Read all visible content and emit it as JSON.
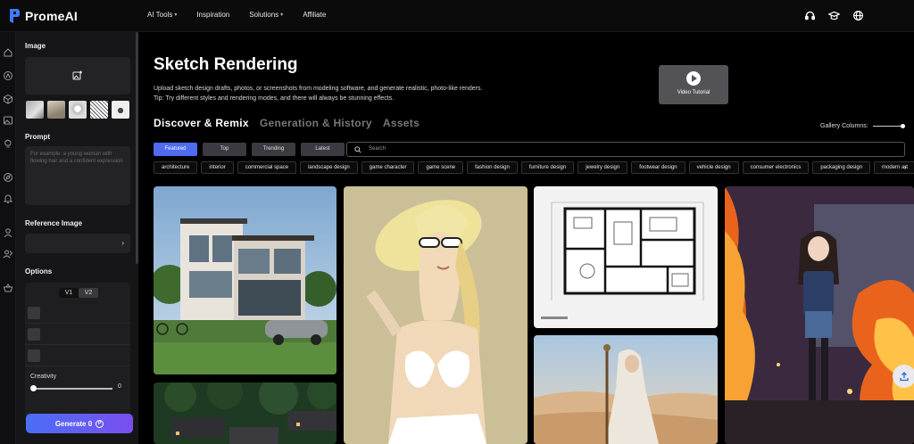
{
  "app": {
    "name": "PromeAI"
  },
  "nav": {
    "items": [
      {
        "label": "AI Tools",
        "has_caret": true
      },
      {
        "label": "Inspiration",
        "has_caret": false
      },
      {
        "label": "Solutions",
        "has_caret": true
      },
      {
        "label": "Affiliate",
        "has_caret": false
      }
    ]
  },
  "top_icons": [
    "headset-icon",
    "graduation-cap-icon",
    "globe-icon"
  ],
  "left_panel": {
    "image_label": "Image",
    "prompt_label": "Prompt",
    "prompt_placeholder": "For example: a young woman with flowing hair and a confident expression",
    "reference_label": "Reference Image",
    "options_label": "Options",
    "version_options": [
      "V1",
      "V2"
    ],
    "version_selected": "V2",
    "creativity_label": "Creativity",
    "creativity_value": "0",
    "generate_label": "Generate 0"
  },
  "main": {
    "title": "Sketch Rendering",
    "description_line1": "Upload sketch design drafts, photos, or screenshots from modeling software, and generate realistic, photo-like renders.",
    "description_line2": "Tip: Try different styles and rendering modes, and there will always be stunning effects.",
    "video_label": "Video Tutorial",
    "tabs": [
      "Discover & Remix",
      "Generation & History",
      "Assets"
    ],
    "active_tab": "Discover & Remix",
    "gallery_columns_label": "Gallery Columns:",
    "filters": [
      "Featured",
      "Top",
      "Trending",
      "Latest"
    ],
    "active_filter": "Featured",
    "search_placeholder": "Search",
    "categories": [
      "architecture",
      "interior",
      "commercial space",
      "landscape design",
      "game character",
      "game scene",
      "fashion design",
      "furniture design",
      "jewelry design",
      "footwear design",
      "vehicle design",
      "consumer electronics",
      "packaging design",
      "modern art"
    ]
  },
  "colors": {
    "accent": "#4f6bf0",
    "generate_gradient_start": "#4b6ef5",
    "generate_gradient_end": "#7a4ff0"
  }
}
